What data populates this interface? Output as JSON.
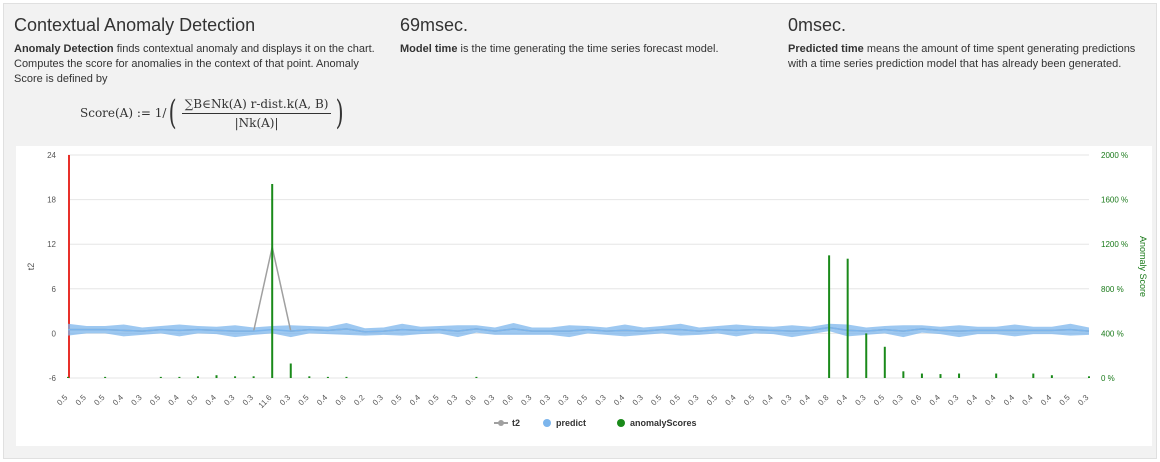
{
  "col1": {
    "title": "Contextual Anomaly Detection",
    "bold": "Anomaly Detection",
    "text": " finds contextual anomaly and displays it on the chart. Computes the score for anomalies in the context of that point. Anomaly Score is defined by",
    "formula_lhs": "Score(A) := 1/",
    "formula_num": "∑B∈Nk(A) r-dist.k(A, B)",
    "formula_den": "|Nk(A)|"
  },
  "col2": {
    "title": "69msec.",
    "bold": "Model time",
    "text": " is the time generating the time series forecast model."
  },
  "col3": {
    "title": "0msec.",
    "bold": "Predicted time",
    "text": " means the amount of time spent generating predictions with a time series prediction model that has already been generated."
  },
  "chart_data": {
    "type": "line",
    "title": "",
    "xlabel": "",
    "ylabel": "t2",
    "y2label": "Anomaly Score",
    "ylim": [
      -6,
      24
    ],
    "yticks": [
      -6,
      0,
      6,
      12,
      18,
      24
    ],
    "y2lim": [
      0,
      2000
    ],
    "y2ticks": [
      "0 %",
      "400 %",
      "800 %",
      "1200 %",
      "1600 %",
      "2000 %"
    ],
    "categories": [
      "0.5",
      "0.5",
      "0.5",
      "0.4",
      "0.3",
      "0.5",
      "0.4",
      "0.5",
      "0.4",
      "0.3",
      "0.3",
      "11.6",
      "0.3",
      "0.5",
      "0.4",
      "0.6",
      "0.2",
      "0.3",
      "0.5",
      "0.4",
      "0.5",
      "0.3",
      "0.6",
      "0.3",
      "0.6",
      "0.3",
      "0.3",
      "0.3",
      "0.5",
      "0.3",
      "0.4",
      "0.3",
      "0.5",
      "0.5",
      "0.3",
      "0.5",
      "0.4",
      "0.5",
      "0.4",
      "0.3",
      "0.4",
      "0.8",
      "0.4",
      "0.3",
      "0.5",
      "0.3",
      "0.6",
      "0.4",
      "0.3",
      "0.4",
      "0.4",
      "0.4",
      "0.4",
      "0.4",
      "0.5",
      "0.3"
    ],
    "grid": true,
    "legend_position": "bottom",
    "series": [
      {
        "name": "t2",
        "color": "#a0a0a0",
        "values": [
          0.5,
          0.5,
          0.5,
          0.4,
          0.3,
          0.5,
          0.4,
          0.5,
          0.4,
          0.3,
          0.3,
          11.6,
          0.3,
          0.5,
          0.4,
          0.6,
          0.2,
          0.3,
          0.5,
          0.4,
          0.5,
          0.3,
          0.6,
          0.3,
          0.6,
          0.3,
          0.3,
          0.3,
          0.5,
          0.3,
          0.4,
          0.3,
          0.5,
          0.5,
          0.3,
          0.5,
          0.4,
          0.5,
          0.4,
          0.3,
          0.4,
          0.8,
          0.4,
          0.3,
          0.5,
          0.3,
          0.6,
          0.4,
          0.3,
          0.4,
          0.4,
          0.4,
          0.4,
          0.4,
          0.5,
          0.3
        ]
      },
      {
        "name": "predict",
        "color": "#7cb5ec",
        "values": [
          0.5,
          0.5,
          0.5,
          0.4,
          0.3,
          0.5,
          0.4,
          0.5,
          0.4,
          0.3,
          0.3,
          0.5,
          0.3,
          0.5,
          0.4,
          0.6,
          0.2,
          0.3,
          0.5,
          0.4,
          0.5,
          0.3,
          0.6,
          0.3,
          0.6,
          0.3,
          0.3,
          0.3,
          0.5,
          0.3,
          0.4,
          0.3,
          0.5,
          0.5,
          0.3,
          0.5,
          0.4,
          0.5,
          0.4,
          0.3,
          0.4,
          0.8,
          0.4,
          0.3,
          0.5,
          0.3,
          0.6,
          0.4,
          0.3,
          0.4,
          0.4,
          0.4,
          0.4,
          0.4,
          0.5,
          0.3
        ]
      },
      {
        "name": "anomalyScores",
        "color": "#1a8a1a",
        "values": [
          10,
          0,
          10,
          0,
          0,
          10,
          10,
          15,
          25,
          15,
          15,
          1740,
          130,
          15,
          10,
          10,
          0,
          0,
          0,
          0,
          0,
          0,
          10,
          0,
          0,
          0,
          0,
          0,
          0,
          0,
          0,
          0,
          0,
          0,
          0,
          0,
          0,
          0,
          0,
          0,
          0,
          1100,
          1070,
          400,
          280,
          60,
          40,
          35,
          40,
          0,
          40,
          0,
          40,
          25,
          0,
          15
        ]
      }
    ]
  },
  "legend": [
    {
      "label": "t2",
      "color": "#a0a0a0"
    },
    {
      "label": "predict",
      "color": "#7cb5ec"
    },
    {
      "label": "anomalyScores",
      "color": "#1a8a1a"
    }
  ]
}
